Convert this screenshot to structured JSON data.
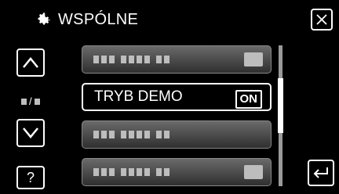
{
  "header": {
    "title": "WSPÓLNE",
    "icon": "gear-icon"
  },
  "nav": {
    "up_icon": "chevron-up-icon",
    "down_icon": "chevron-down-icon",
    "help_label": "?",
    "page_indicator_sep": "/"
  },
  "list": {
    "items": [
      {
        "label": "",
        "value": ""
      },
      {
        "label": "TRYB DEMO",
        "value": "ON"
      },
      {
        "label": "",
        "value": ""
      },
      {
        "label": "",
        "value": ""
      }
    ],
    "selected_index": 1
  },
  "colors": {
    "background": "#000000",
    "item_bg": "#4a4a4a",
    "text": "#ffffff"
  }
}
